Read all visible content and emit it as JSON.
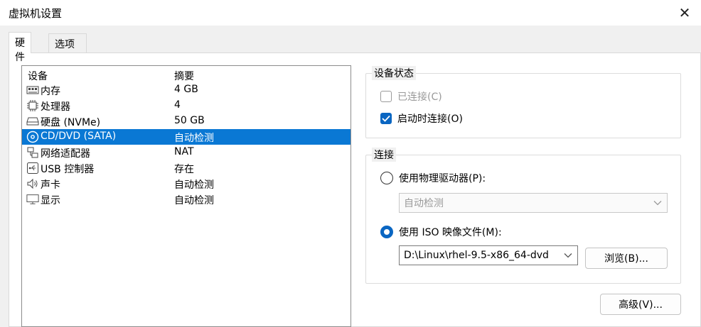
{
  "window": {
    "title": "虚拟机设置",
    "close_glyph": "✕"
  },
  "tabs": [
    {
      "label": "硬件"
    },
    {
      "label": "选项"
    }
  ],
  "device_list": {
    "headers": {
      "device": "设备",
      "summary": "摘要"
    },
    "rows": [
      {
        "name": "内存",
        "summary": "4 GB",
        "icon": "memory-icon"
      },
      {
        "name": "处理器",
        "summary": "4",
        "icon": "processor-icon"
      },
      {
        "name": "硬盘 (NVMe)",
        "summary": "50 GB",
        "icon": "hard-disk-icon"
      },
      {
        "name": "CD/DVD (SATA)",
        "summary": "自动检测",
        "icon": "cd-dvd-icon",
        "selected": true
      },
      {
        "name": "网络适配器",
        "summary": "NAT",
        "icon": "network-adapter-icon"
      },
      {
        "name": "USB 控制器",
        "summary": "存在",
        "icon": "usb-controller-icon"
      },
      {
        "name": "声卡",
        "summary": "自动检测",
        "icon": "sound-card-icon"
      },
      {
        "name": "显示",
        "summary": "自动检测",
        "icon": "display-icon"
      }
    ]
  },
  "device_status": {
    "title": "设备状态",
    "connected": {
      "label": "已连接(C)",
      "checked": false,
      "disabled": true
    },
    "connect_at_power_on": {
      "label": "启动时连接(O)",
      "checked": true
    }
  },
  "connection": {
    "title": "连接",
    "physical_drive": {
      "label": "使用物理驱动器(P):",
      "selected": false
    },
    "physical_drive_select": {
      "value": "自动检测"
    },
    "iso_image": {
      "label": "使用 ISO 映像文件(M):",
      "selected": true
    },
    "iso_path": {
      "value": "D:\\Linux\\rhel-9.5-x86_64-dvd"
    },
    "browse_button": "浏览(B)..."
  },
  "advanced_button": "高级(V)...",
  "colors": {
    "selection": "#0a78d4",
    "accent": "#0a66c2",
    "background": "#f0f0f0"
  }
}
